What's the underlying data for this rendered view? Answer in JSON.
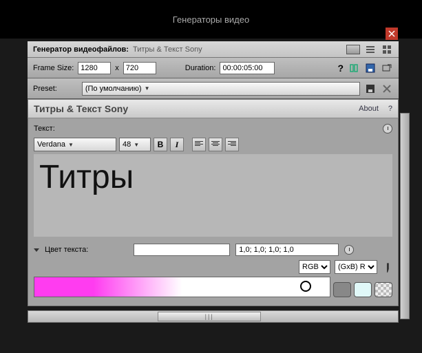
{
  "window": {
    "title": "Генераторы видео"
  },
  "header": {
    "generator_label": "Генератор видеофайлов:",
    "generator_value": "Титры & Текст Sony"
  },
  "frame": {
    "size_label": "Frame Size:",
    "width": "1280",
    "x": "x",
    "height": "720",
    "duration_label": "Duration:",
    "duration_value": "00:00:05:00",
    "help": "?"
  },
  "preset": {
    "label": "Preset:",
    "value": "(По умолчанию)"
  },
  "plugin": {
    "title": "Титры & Текст Sony",
    "about": "About",
    "help": "?"
  },
  "text_section": {
    "label": "Текст:"
  },
  "format": {
    "font": "Verdana",
    "size": "48",
    "bold": "B",
    "italic": "I"
  },
  "canvas": {
    "text": "Титры"
  },
  "color": {
    "label": "Цвет текста:",
    "rgba": "1,0; 1,0; 1,0; 1,0",
    "mode1": "RGB",
    "mode2": "(GxB) R"
  },
  "scrollbar": {
    "grip": "|||"
  }
}
